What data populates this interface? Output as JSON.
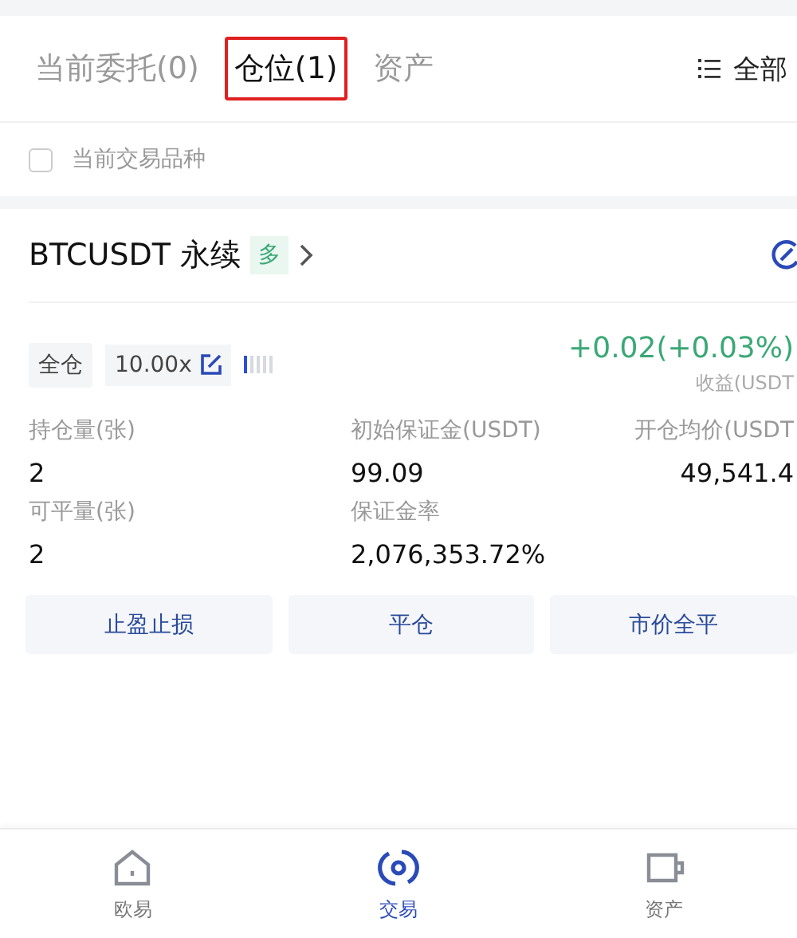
{
  "tabs": [
    {
      "label": "当前委托(0)",
      "selected": false
    },
    {
      "label": "仓位(1)",
      "selected": true
    },
    {
      "label": "资产",
      "selected": false
    }
  ],
  "filter": {
    "label": "全部"
  },
  "current_symbol_only": {
    "label": "当前交易品种",
    "checked": false
  },
  "position": {
    "symbol": "BTCUSDT 永续",
    "side": "多",
    "margin_mode": "全仓",
    "leverage": "10.00x",
    "pnl": "+0.02(+0.03%)",
    "pnl_label": "收益(USDT",
    "fields": [
      {
        "label": "持仓量(张)",
        "value": "2"
      },
      {
        "label": "初始保证金(USDT)",
        "value": "99.09"
      },
      {
        "label": "开仓均价(USDT",
        "value": "49,541.4"
      },
      {
        "label": "可平量(张)",
        "value": "2"
      },
      {
        "label": "保证金率",
        "value": "2,076,353.72%"
      }
    ],
    "actions": [
      "止盈止损",
      "平仓",
      "市价全平"
    ]
  },
  "nav": [
    {
      "label": "欧易",
      "kind": "home",
      "selected": false
    },
    {
      "label": "交易",
      "kind": "trade",
      "selected": true
    },
    {
      "label": "资产",
      "kind": "wallet",
      "selected": false
    }
  ]
}
